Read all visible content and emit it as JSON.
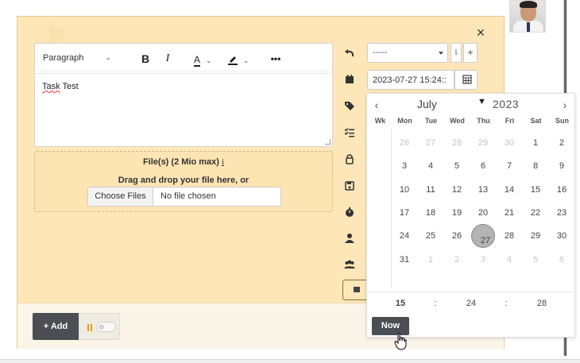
{
  "avatar": {
    "alt": "user avatar"
  },
  "modal": {
    "close_label": "×"
  },
  "editor": {
    "block_style": "Paragraph",
    "bold_label": "B",
    "italic_label": "I",
    "font_color_label": "A",
    "more_label": "•••",
    "content_first_word": "Task",
    "content_rest": " Test"
  },
  "dropzone": {
    "title": "File(s) (2 Mio max)",
    "info_icon": "i",
    "subtitle": "Drag and drop your file here, or",
    "choose_label": "Choose Files",
    "no_file_label": "No file chosen"
  },
  "form": {
    "select_value": "-----",
    "info_label": "i",
    "plus_label": "+",
    "date_value": "2023-07-27 15:24::"
  },
  "footer": {
    "add_label": "+ Add"
  },
  "calendar": {
    "prev_label": "‹",
    "next_label": "›",
    "month": "July",
    "year": "2023",
    "weekdays": [
      "Wk",
      "Mon",
      "Tue",
      "Wed",
      "Thu",
      "Fri",
      "Sat",
      "Sun"
    ],
    "weeks": [
      [
        {
          "d": "26",
          "m": true
        },
        {
          "d": "27",
          "m": true
        },
        {
          "d": "28",
          "m": true
        },
        {
          "d": "29",
          "m": true
        },
        {
          "d": "30",
          "m": true
        },
        {
          "d": "1"
        },
        {
          "d": "2"
        }
      ],
      [
        {
          "d": "3"
        },
        {
          "d": "4"
        },
        {
          "d": "5"
        },
        {
          "d": "6"
        },
        {
          "d": "7"
        },
        {
          "d": "8"
        },
        {
          "d": "9"
        }
      ],
      [
        {
          "d": "10"
        },
        {
          "d": "11"
        },
        {
          "d": "12"
        },
        {
          "d": "13"
        },
        {
          "d": "14"
        },
        {
          "d": "15"
        },
        {
          "d": "16"
        }
      ],
      [
        {
          "d": "17"
        },
        {
          "d": "18"
        },
        {
          "d": "19"
        },
        {
          "d": "20"
        },
        {
          "d": "21"
        },
        {
          "d": "22"
        },
        {
          "d": "23"
        }
      ],
      [
        {
          "d": "24"
        },
        {
          "d": "25"
        },
        {
          "d": "26"
        },
        {
          "d": "27",
          "s": true
        },
        {
          "d": "28"
        },
        {
          "d": "29"
        },
        {
          "d": "30"
        }
      ],
      [
        {
          "d": "31"
        },
        {
          "d": "1",
          "m": true
        },
        {
          "d": "2",
          "m": true
        },
        {
          "d": "3",
          "m": true
        },
        {
          "d": "4",
          "m": true
        },
        {
          "d": "5",
          "m": true
        },
        {
          "d": "6",
          "m": true
        }
      ]
    ],
    "time": {
      "hour": "15",
      "minute": "24",
      "second": "28",
      "sep": ":"
    },
    "now_label": "Now"
  },
  "sidebar_icons": [
    "undo-icon",
    "calendar-icon",
    "tag-icon",
    "checklist-icon",
    "lock-icon",
    "save-icon",
    "stopwatch-icon",
    "user-icon",
    "users-icon"
  ],
  "colors": {
    "panel": "#fde6b8",
    "dark_button": "#4b4f54",
    "accent_orange": "#e39b1b"
  }
}
